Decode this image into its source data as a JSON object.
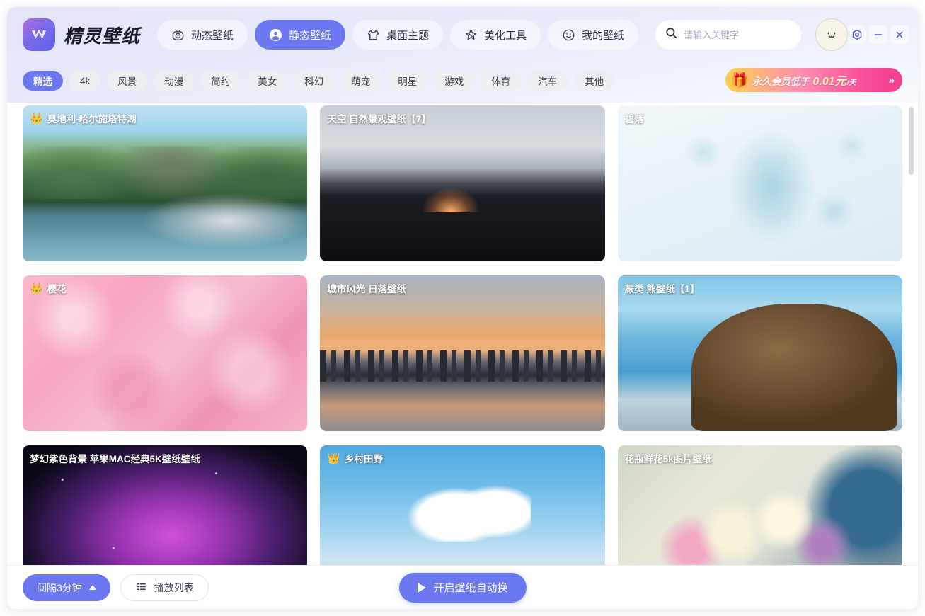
{
  "app": {
    "title": "精灵壁纸",
    "logo_icon": "wallpaper-logo-icon",
    "accent_color": "#6b78f0"
  },
  "nav": {
    "tabs": [
      {
        "label": "动态壁纸",
        "icon": "live-wallpaper-icon",
        "active": false
      },
      {
        "label": "静态壁纸",
        "icon": "static-wallpaper-icon",
        "active": true
      },
      {
        "label": "桌面主题",
        "icon": "desktop-theme-icon",
        "active": false
      },
      {
        "label": "美化工具",
        "icon": "beautify-tool-icon",
        "active": false
      },
      {
        "label": "我的壁纸",
        "icon": "my-wallpaper-icon",
        "active": false
      }
    ]
  },
  "search": {
    "placeholder": "请输入关键字",
    "value": "",
    "icon": "search-icon"
  },
  "user": {
    "avatar_icon": "smiley-avatar-icon"
  },
  "window_controls": [
    {
      "name": "settings-button",
      "icon": "gear-icon"
    },
    {
      "name": "minimize-button",
      "icon": "minimize-icon"
    },
    {
      "name": "close-button",
      "icon": "close-icon"
    }
  ],
  "categories": [
    {
      "label": "精选",
      "active": true
    },
    {
      "label": "4k",
      "active": false
    },
    {
      "label": "风景",
      "active": false
    },
    {
      "label": "动漫",
      "active": false
    },
    {
      "label": "简约",
      "active": false
    },
    {
      "label": "美女",
      "active": false
    },
    {
      "label": "科幻",
      "active": false
    },
    {
      "label": "萌宠",
      "active": false
    },
    {
      "label": "明星",
      "active": false
    },
    {
      "label": "游戏",
      "active": false
    },
    {
      "label": "体育",
      "active": false
    },
    {
      "label": "汽车",
      "active": false
    },
    {
      "label": "其他",
      "active": false
    }
  ],
  "promo": {
    "gift_icon": "gift-box-icon",
    "text_before": "永久会员低于",
    "price": "0.01元",
    "price_unit": "/天",
    "arrow": "»"
  },
  "wallpapers": [
    {
      "title": "奥地利-哈尔施塔特湖",
      "vip": true,
      "art": "t-hallstatt"
    },
    {
      "title": "天空 自然景观壁纸【7】",
      "vip": false,
      "art": "t-sky"
    },
    {
      "title": "碧落",
      "vip": false,
      "art": "t-biluo"
    },
    {
      "title": "樱花",
      "vip": true,
      "art": "t-sakura"
    },
    {
      "title": "城市风光 日落壁纸",
      "vip": false,
      "art": "t-city"
    },
    {
      "title": "蕨类 熊壁纸【1】",
      "vip": false,
      "art": "t-bear"
    },
    {
      "title": "梦幻紫色背景 苹果MAC经典5K壁纸壁纸",
      "vip": false,
      "art": "t-mac"
    },
    {
      "title": "乡村田野",
      "vip": true,
      "art": "t-country"
    },
    {
      "title": "花瓶鲜花5k图片壁纸",
      "vip": false,
      "art": "t-flowers"
    }
  ],
  "crown_glyph": "👑",
  "footer": {
    "interval_label": "间隔3分钟",
    "interval_caret_icon": "caret-up-icon",
    "playlist_label": "播放列表",
    "playlist_icon": "playlist-icon",
    "auto_label": "开启壁纸自动换",
    "auto_icon": "play-icon"
  }
}
